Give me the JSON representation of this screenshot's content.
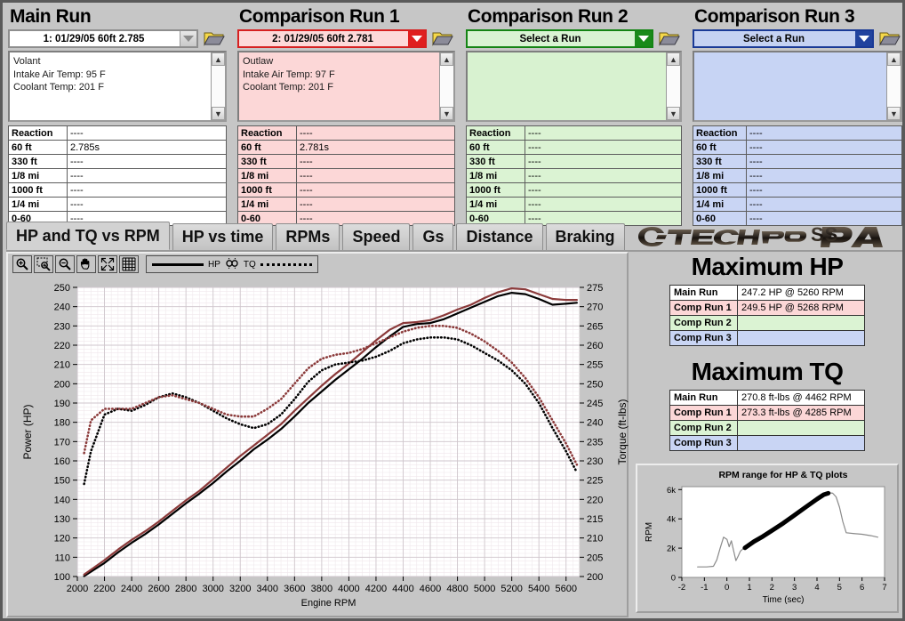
{
  "runs": [
    {
      "title": "Main Run",
      "selected_run": "1:   01/29/05 60ft 2.785",
      "notes": "Volant\nIntake Air Temp: 95 F\nCoolant Temp: 201 F",
      "stats": [
        {
          "label": "Reaction",
          "value": "----"
        },
        {
          "label": "60 ft",
          "value": "2.785s"
        },
        {
          "label": "330 ft",
          "value": "----"
        },
        {
          "label": "1/8 mi",
          "value": "----"
        },
        {
          "label": "1000 ft",
          "value": "----"
        },
        {
          "label": "1/4 mi",
          "value": "----"
        },
        {
          "label": "0-60",
          "value": "----"
        }
      ]
    },
    {
      "title": "Comparison Run 1",
      "selected_run": "2:   01/29/05 60ft 2.781",
      "notes": "Outlaw\nIntake Air Temp: 97 F\nCoolant Temp: 201 F",
      "stats": [
        {
          "label": "Reaction",
          "value": "----"
        },
        {
          "label": "60 ft",
          "value": "2.781s"
        },
        {
          "label": "330 ft",
          "value": "----"
        },
        {
          "label": "1/8 mi",
          "value": "----"
        },
        {
          "label": "1000 ft",
          "value": "----"
        },
        {
          "label": "1/4 mi",
          "value": "----"
        },
        {
          "label": "0-60",
          "value": "----"
        }
      ]
    },
    {
      "title": "Comparison Run 2",
      "selected_run": "Select a Run",
      "notes": "",
      "stats": [
        {
          "label": "Reaction",
          "value": "----"
        },
        {
          "label": "60 ft",
          "value": "----"
        },
        {
          "label": "330 ft",
          "value": "----"
        },
        {
          "label": "1/8 mi",
          "value": "----"
        },
        {
          "label": "1000 ft",
          "value": "----"
        },
        {
          "label": "1/4 mi",
          "value": "----"
        },
        {
          "label": "0-60",
          "value": "----"
        }
      ]
    },
    {
      "title": "Comparison Run 3",
      "selected_run": "Select a Run",
      "notes": "",
      "stats": [
        {
          "label": "Reaction",
          "value": "----"
        },
        {
          "label": "60 ft",
          "value": "----"
        },
        {
          "label": "330 ft",
          "value": "----"
        },
        {
          "label": "1/8 mi",
          "value": "----"
        },
        {
          "label": "1000 ft",
          "value": "----"
        },
        {
          "label": "1/4 mi",
          "value": "----"
        },
        {
          "label": "0-60",
          "value": "----"
        }
      ]
    }
  ],
  "tabs": [
    {
      "label": "HP and TQ vs RPM",
      "active": true
    },
    {
      "label": "HP vs time",
      "active": false
    },
    {
      "label": "RPMs",
      "active": false
    },
    {
      "label": "Speed",
      "active": false
    },
    {
      "label": "Gs",
      "active": false
    },
    {
      "label": "Distance",
      "active": false
    },
    {
      "label": "Braking",
      "active": false
    }
  ],
  "logo": {
    "brand": "GTECHPRO",
    "product": "PASS"
  },
  "graph_toolbar": {
    "buttons": [
      "zoom-in-icon",
      "zoom-box-icon",
      "zoom-out-icon",
      "pan-hand-icon",
      "fit-arrows-icon",
      "grid-icon"
    ],
    "legend": {
      "hp_label": "HP",
      "tq_label": "TQ",
      "mid_icon": "link-icon"
    }
  },
  "maximum_hp": {
    "heading": "Maximum HP",
    "rows": [
      {
        "label": "Main Run",
        "value": "247.2 HP @ 5260 RPM"
      },
      {
        "label": "Comp Run 1",
        "value": "249.5 HP @ 5268 RPM"
      },
      {
        "label": "Comp Run 2",
        "value": ""
      },
      {
        "label": "Comp Run 3",
        "value": ""
      }
    ]
  },
  "maximum_tq": {
    "heading": "Maximum TQ",
    "rows": [
      {
        "label": "Main Run",
        "value": "270.8 ft-lbs @ 4462 RPM"
      },
      {
        "label": "Comp Run 1",
        "value": "273.3 ft-lbs @ 4285 RPM"
      },
      {
        "label": "Comp Run 2",
        "value": ""
      },
      {
        "label": "Comp Run 3",
        "value": ""
      }
    ]
  },
  "colors": {
    "main_run": "#000000",
    "comp_run_1": "#8b3a3a",
    "comp_run_2": "#1a8a1a",
    "comp_run_3": "#21439e",
    "panel_bg": "#c6c6c6",
    "plot_bg": "#ffffff"
  },
  "chart_data": [
    {
      "type": "line",
      "title": "HP and TQ vs RPM",
      "xlabel": "Engine RPM",
      "ylabel": "Power (HP)",
      "y2label": "Torque (ft-lbs)",
      "xlim": [
        2000,
        5700
      ],
      "ylim": [
        100,
        250
      ],
      "y2lim": [
        200,
        275
      ],
      "xticks": [
        2000,
        2200,
        2400,
        2600,
        2800,
        3000,
        3200,
        3400,
        3600,
        3800,
        4000,
        4200,
        4400,
        4600,
        4800,
        5000,
        5200,
        5400,
        5600
      ],
      "yticks": [
        100,
        110,
        120,
        130,
        140,
        150,
        160,
        170,
        180,
        190,
        200,
        210,
        220,
        230,
        240,
        250
      ],
      "y2ticks": [
        200,
        205,
        210,
        215,
        220,
        225,
        230,
        235,
        240,
        245,
        250,
        255,
        260,
        265,
        270,
        275
      ],
      "grid": true,
      "legend_position": "toolbar",
      "x": [
        2050,
        2100,
        2200,
        2300,
        2400,
        2500,
        2600,
        2700,
        2800,
        2900,
        3000,
        3100,
        3200,
        3300,
        3400,
        3500,
        3600,
        3700,
        3800,
        3900,
        4000,
        4100,
        4200,
        4300,
        4400,
        4500,
        4600,
        4700,
        4800,
        4900,
        5000,
        5100,
        5200,
        5300,
        5400,
        5500,
        5600,
        5680
      ],
      "series": [
        {
          "name": "Main Run HP",
          "axis": "left",
          "style": "solid",
          "color": "#000000",
          "values": [
            100.2,
            102.5,
            107.0,
            112.5,
            117.5,
            122.0,
            127.0,
            132.5,
            138.0,
            143.0,
            148.5,
            154.5,
            160.0,
            166.0,
            171.0,
            176.5,
            183.0,
            190.0,
            196.0,
            202.0,
            207.5,
            213.0,
            219.0,
            224.5,
            229.5,
            231.0,
            231.5,
            233.5,
            236.5,
            239.5,
            242.5,
            245.5,
            247.2,
            246.5,
            244.0,
            241.0,
            241.5,
            242.0
          ]
        },
        {
          "name": "Comp Run 1 HP",
          "axis": "left",
          "style": "solid",
          "color": "#8b3a3a",
          "values": [
            101.0,
            103.5,
            108.5,
            114.0,
            119.0,
            123.5,
            128.5,
            134.0,
            139.5,
            144.5,
            150.5,
            156.5,
            162.5,
            168.0,
            173.5,
            179.0,
            186.0,
            192.5,
            199.0,
            205.0,
            210.5,
            216.5,
            222.5,
            228.0,
            231.5,
            232.0,
            233.0,
            235.5,
            238.5,
            241.0,
            244.5,
            247.5,
            249.5,
            249.0,
            246.5,
            244.0,
            243.5,
            243.5
          ]
        },
        {
          "name": "Main Run TQ",
          "axis": "right",
          "style": "dotted",
          "color": "#000000",
          "values": [
            224.0,
            232.5,
            242.0,
            243.5,
            243.0,
            244.5,
            246.5,
            247.5,
            246.5,
            245.0,
            243.0,
            241.0,
            239.5,
            238.5,
            239.5,
            242.0,
            246.0,
            250.5,
            253.5,
            255.0,
            255.5,
            256.0,
            257.0,
            258.5,
            260.5,
            261.5,
            262.0,
            262.0,
            261.5,
            260.0,
            258.0,
            256.0,
            253.5,
            250.0,
            245.0,
            238.5,
            232.5,
            227.0
          ]
        },
        {
          "name": "Comp Run 1 TQ",
          "axis": "right",
          "style": "dotted",
          "color": "#8b3a3a",
          "values": [
            232.0,
            240.5,
            243.5,
            243.5,
            243.5,
            245.0,
            246.5,
            247.0,
            246.0,
            245.0,
            243.5,
            242.0,
            241.5,
            241.5,
            243.5,
            246.0,
            250.0,
            254.0,
            256.5,
            257.5,
            258.0,
            259.0,
            260.5,
            262.0,
            263.5,
            264.5,
            265.0,
            265.0,
            264.5,
            263.0,
            261.0,
            258.5,
            255.5,
            251.5,
            246.5,
            240.5,
            234.5,
            229.0
          ]
        }
      ]
    },
    {
      "type": "line",
      "title": "RPM range for HP & TQ plots",
      "xlabel": "Time (sec)",
      "ylabel": "RPM",
      "xlim": [
        -2,
        7
      ],
      "ylim": [
        0,
        6200
      ],
      "xticks": [
        -2,
        -1,
        0,
        1,
        2,
        3,
        4,
        5,
        6,
        7
      ],
      "yticks": [
        0,
        2000,
        4000,
        6000
      ],
      "ytick_labels": [
        "0",
        "2k",
        "4k",
        "6k"
      ],
      "grid": false,
      "series": [
        {
          "name": "RPM trace",
          "color": "#8a8a8a",
          "x": [
            -1.3,
            -0.9,
            -0.6,
            -0.45,
            -0.3,
            -0.15,
            0.0,
            0.1,
            0.2,
            0.3,
            0.4,
            0.5,
            0.6,
            0.75,
            0.9,
            1.2,
            1.6,
            2.0,
            2.5,
            3.0,
            3.5,
            4.0,
            4.3,
            4.55,
            4.7,
            4.85,
            5.0,
            5.15,
            5.3,
            5.6,
            6.0,
            6.4,
            6.7
          ],
          "y": [
            720,
            720,
            760,
            1200,
            2000,
            2750,
            2600,
            2100,
            2500,
            1800,
            1150,
            1450,
            1800,
            2000,
            2150,
            2450,
            2800,
            3200,
            3700,
            4250,
            4800,
            5350,
            5650,
            5780,
            5750,
            5500,
            4800,
            3800,
            3050,
            3000,
            2950,
            2850,
            2750
          ]
        },
        {
          "name": "Highlighted HP/TQ range",
          "color": "#000000",
          "x": [
            0.8,
            1.2,
            1.6,
            2.0,
            2.5,
            3.0,
            3.5,
            4.0,
            4.3,
            4.5
          ],
          "y": [
            2020,
            2450,
            2800,
            3200,
            3700,
            4250,
            4800,
            5350,
            5650,
            5750
          ]
        }
      ]
    }
  ]
}
